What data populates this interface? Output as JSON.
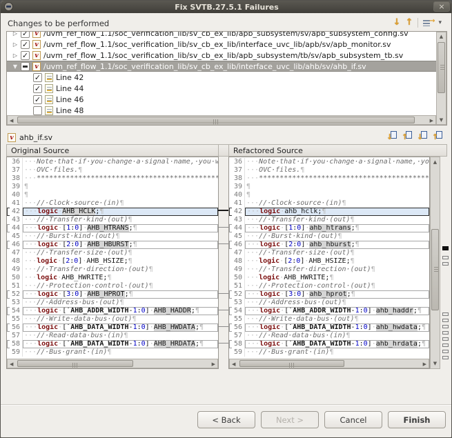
{
  "window": {
    "title": "Fix SVTB.27.5.1 Failures"
  },
  "icons": {
    "close": "×",
    "down_arrow": "↓",
    "up_arrow": "↑",
    "chevron": "▾",
    "filter_arrow": "→",
    "collapsed": "▷",
    "expanded": "▼",
    "check": "✓",
    "sv_letter": "v",
    "scroll_up": "▲",
    "scroll_down": "▼",
    "scroll_left": "◀",
    "scroll_right": "▶"
  },
  "changes": {
    "label": "Changes to be performed",
    "tree": [
      {
        "kind": "file",
        "expander": "collapsed",
        "check": "checked",
        "clipped": true,
        "label": "/uvm_ref_flow_1.1/soc_verification_lib/sv_cb_ex_lib/apb_subsystem/sv/apb_subsystem_config.sv"
      },
      {
        "kind": "file",
        "expander": "collapsed",
        "check": "checked",
        "label": "/uvm_ref_flow_1.1/soc_verification_lib/sv_cb_ex_lib/interface_uvc_lib/apb/sv/apb_monitor.sv"
      },
      {
        "kind": "file",
        "expander": "collapsed",
        "check": "checked",
        "label": "/uvm_ref_flow_1.1/soc_verification_lib/sv_cb_ex_lib/apb_subsystem/tb/sv/apb_subsystem_tb.sv"
      },
      {
        "kind": "file",
        "expander": "expanded",
        "check": "partial",
        "selected": true,
        "label": "/uvm_ref_flow_1.1/soc_verification_lib/sv_cb_ex_lib/interface_uvc_lib/ahb/sv/ahb_if.sv"
      },
      {
        "kind": "line",
        "check": "checked",
        "indent": 1,
        "label": "Line 42"
      },
      {
        "kind": "line",
        "check": "checked",
        "indent": 1,
        "label": "Line 44"
      },
      {
        "kind": "line",
        "check": "checked",
        "indent": 1,
        "label": "Line 46"
      },
      {
        "kind": "line",
        "check": "unchecked",
        "indent": 1,
        "label": "Line 48"
      }
    ]
  },
  "compare": {
    "file": "ahb_if.sv",
    "left_header": "Original Source",
    "right_header": "Refactored Source",
    "ruler": {
      "current": 130,
      "others": [
        144,
        153,
        226,
        235,
        244,
        253,
        262,
        271,
        280,
        289
      ]
    },
    "lines": [
      {
        "num": 36,
        "left": [
          [
            "ws",
            "···"
          ],
          [
            "com",
            "Note·that·if·you·change·a·signal·name,·you·will·need·to·update"
          ],
          [
            "ws",
            "¶"
          ]
        ]
      },
      {
        "num": 37,
        "left": [
          [
            "ws",
            "···"
          ],
          [
            "com",
            "OVC·files."
          ],
          [
            "ws",
            "¶"
          ]
        ]
      },
      {
        "num": 38,
        "left": [
          [
            "ws",
            "···"
          ],
          [
            "com",
            "*********************************************************************"
          ]
        ]
      },
      {
        "num": 39,
        "left": [
          [
            "ws",
            "¶"
          ]
        ]
      },
      {
        "num": 40,
        "left": [
          [
            "ws",
            "¶"
          ]
        ]
      },
      {
        "num": 41,
        "left": [
          [
            "ws",
            "···"
          ],
          [
            "com",
            "//·Clock·source·(in)"
          ],
          [
            "ws",
            "¶"
          ]
        ]
      },
      {
        "num": 42,
        "diff": "selected",
        "left": [
          [
            "ws",
            "···"
          ],
          [
            "kw",
            "logic"
          ],
          [
            "ws",
            "·"
          ],
          [
            "chg",
            "AHB_HCLK"
          ],
          [
            "pln",
            ";"
          ],
          [
            "ws",
            "¶"
          ]
        ],
        "right": [
          [
            "ws",
            "···"
          ],
          [
            "kw",
            "logic"
          ],
          [
            "ws",
            "·"
          ],
          [
            "pln",
            "ahb_hclk"
          ],
          [
            "pln",
            ";"
          ],
          [
            "ws",
            "¶"
          ]
        ]
      },
      {
        "num": 43,
        "left": [
          [
            "ws",
            "···"
          ],
          [
            "com",
            "//·Transfer·kind·(out)"
          ],
          [
            "ws",
            "¶"
          ]
        ]
      },
      {
        "num": 44,
        "diff": "changed",
        "left": [
          [
            "ws",
            "···"
          ],
          [
            "kw",
            "logic"
          ],
          [
            "ws",
            "·"
          ],
          [
            "pln",
            "["
          ],
          [
            "num",
            "1"
          ],
          [
            "pln",
            ":"
          ],
          [
            "num",
            "0"
          ],
          [
            "pln",
            "]"
          ],
          [
            "ws",
            "·"
          ],
          [
            "chg",
            "AHB_HTRANS"
          ],
          [
            "pln",
            ";"
          ],
          [
            "ws",
            "¶"
          ]
        ],
        "right": [
          [
            "ws",
            "···"
          ],
          [
            "kw",
            "logic"
          ],
          [
            "ws",
            "·"
          ],
          [
            "pln",
            "["
          ],
          [
            "num",
            "1"
          ],
          [
            "pln",
            ":"
          ],
          [
            "num",
            "0"
          ],
          [
            "pln",
            "]"
          ],
          [
            "ws",
            "·"
          ],
          [
            "chg",
            "ahb_htrans"
          ],
          [
            "pln",
            ";"
          ],
          [
            "ws",
            "¶"
          ]
        ]
      },
      {
        "num": 45,
        "left": [
          [
            "ws",
            "···"
          ],
          [
            "com",
            "//·Burst·kind·(out)"
          ],
          [
            "ws",
            "¶"
          ]
        ]
      },
      {
        "num": 46,
        "diff": "changed",
        "left": [
          [
            "ws",
            "···"
          ],
          [
            "kw",
            "logic"
          ],
          [
            "ws",
            "·"
          ],
          [
            "pln",
            "["
          ],
          [
            "num",
            "2"
          ],
          [
            "pln",
            ":"
          ],
          [
            "num",
            "0"
          ],
          [
            "pln",
            "]"
          ],
          [
            "ws",
            "·"
          ],
          [
            "chg",
            "AHB_HBURST"
          ],
          [
            "pln",
            ";"
          ],
          [
            "ws",
            "¶"
          ]
        ],
        "right": [
          [
            "ws",
            "···"
          ],
          [
            "kw",
            "logic"
          ],
          [
            "ws",
            "·"
          ],
          [
            "pln",
            "["
          ],
          [
            "num",
            "2"
          ],
          [
            "pln",
            ":"
          ],
          [
            "num",
            "0"
          ],
          [
            "pln",
            "]"
          ],
          [
            "ws",
            "·"
          ],
          [
            "chg",
            "ahb_hburst"
          ],
          [
            "pln",
            ";"
          ],
          [
            "ws",
            "¶"
          ]
        ]
      },
      {
        "num": 47,
        "left": [
          [
            "ws",
            "···"
          ],
          [
            "com",
            "//·Transfer·size·(out)"
          ],
          [
            "ws",
            "¶"
          ]
        ]
      },
      {
        "num": 48,
        "left": [
          [
            "ws",
            "···"
          ],
          [
            "kw",
            "logic"
          ],
          [
            "ws",
            "·"
          ],
          [
            "pln",
            "["
          ],
          [
            "num",
            "2"
          ],
          [
            "pln",
            ":"
          ],
          [
            "num",
            "0"
          ],
          [
            "pln",
            "]"
          ],
          [
            "ws",
            "·"
          ],
          [
            "pln",
            "AHB_HSIZE"
          ],
          [
            "pln",
            ";"
          ],
          [
            "ws",
            "¶"
          ]
        ]
      },
      {
        "num": 49,
        "left": [
          [
            "ws",
            "···"
          ],
          [
            "com",
            "//·Transfer·direction·(out)"
          ],
          [
            "ws",
            "¶"
          ]
        ]
      },
      {
        "num": 50,
        "left": [
          [
            "ws",
            "···"
          ],
          [
            "kw",
            "logic"
          ],
          [
            "ws",
            "·"
          ],
          [
            "pln",
            "AHB_HWRITE"
          ],
          [
            "pln",
            ";"
          ],
          [
            "ws",
            "¶"
          ]
        ]
      },
      {
        "num": 51,
        "left": [
          [
            "ws",
            "···"
          ],
          [
            "com",
            "//·Protection·control·(out)"
          ],
          [
            "ws",
            "¶"
          ]
        ]
      },
      {
        "num": 52,
        "diff": "changed",
        "left": [
          [
            "ws",
            "···"
          ],
          [
            "kw",
            "logic"
          ],
          [
            "ws",
            "·"
          ],
          [
            "pln",
            "["
          ],
          [
            "num",
            "3"
          ],
          [
            "pln",
            ":"
          ],
          [
            "num",
            "0"
          ],
          [
            "pln",
            "]"
          ],
          [
            "ws",
            "·"
          ],
          [
            "chg",
            "AHB_HPROT"
          ],
          [
            "pln",
            ";"
          ],
          [
            "ws",
            "¶"
          ]
        ],
        "right": [
          [
            "ws",
            "···"
          ],
          [
            "kw",
            "logic"
          ],
          [
            "ws",
            "·"
          ],
          [
            "pln",
            "["
          ],
          [
            "num",
            "3"
          ],
          [
            "pln",
            ":"
          ],
          [
            "num",
            "0"
          ],
          [
            "pln",
            "]"
          ],
          [
            "ws",
            "·"
          ],
          [
            "chg",
            "ahb_hprot"
          ],
          [
            "pln",
            ";"
          ],
          [
            "ws",
            "¶"
          ]
        ]
      },
      {
        "num": 53,
        "left": [
          [
            "ws",
            "···"
          ],
          [
            "com",
            "//·Address·bus·(out)"
          ],
          [
            "ws",
            "¶"
          ]
        ]
      },
      {
        "num": 54,
        "diff": "changed",
        "left": [
          [
            "ws",
            "···"
          ],
          [
            "kw",
            "logic"
          ],
          [
            "ws",
            "·"
          ],
          [
            "pln",
            "["
          ],
          [
            "mac",
            "`AHB_ADDR_WIDTH"
          ],
          [
            "pln",
            "-"
          ],
          [
            "num",
            "1"
          ],
          [
            "pln",
            ":"
          ],
          [
            "num",
            "0"
          ],
          [
            "pln",
            "]"
          ],
          [
            "ws",
            "·"
          ],
          [
            "chg",
            "AHB_HADDR"
          ],
          [
            "pln",
            ";"
          ],
          [
            "ws",
            "¶"
          ]
        ],
        "right": [
          [
            "ws",
            "···"
          ],
          [
            "kw",
            "logic"
          ],
          [
            "ws",
            "·"
          ],
          [
            "pln",
            "["
          ],
          [
            "mac",
            "`AHB_ADDR_WIDTH"
          ],
          [
            "pln",
            "-"
          ],
          [
            "num",
            "1"
          ],
          [
            "pln",
            ":"
          ],
          [
            "num",
            "0"
          ],
          [
            "pln",
            "]"
          ],
          [
            "ws",
            "·"
          ],
          [
            "chg",
            "ahb_haddr"
          ],
          [
            "pln",
            ";"
          ],
          [
            "ws",
            "¶"
          ]
        ]
      },
      {
        "num": 55,
        "left": [
          [
            "ws",
            "···"
          ],
          [
            "com",
            "//·Write·data·bus·(out)"
          ],
          [
            "ws",
            "¶"
          ]
        ]
      },
      {
        "num": 56,
        "diff": "changed",
        "left": [
          [
            "ws",
            "···"
          ],
          [
            "kw",
            "logic"
          ],
          [
            "ws",
            "·"
          ],
          [
            "pln",
            "["
          ],
          [
            "mac",
            "`AHB_DATA_WIDTH"
          ],
          [
            "pln",
            "-"
          ],
          [
            "num",
            "1"
          ],
          [
            "pln",
            ":"
          ],
          [
            "num",
            "0"
          ],
          [
            "pln",
            "]"
          ],
          [
            "ws",
            "·"
          ],
          [
            "chg",
            "AHB_HWDATA"
          ],
          [
            "pln",
            ";"
          ],
          [
            "ws",
            "¶"
          ]
        ],
        "right": [
          [
            "ws",
            "···"
          ],
          [
            "kw",
            "logic"
          ],
          [
            "ws",
            "·"
          ],
          [
            "pln",
            "["
          ],
          [
            "mac",
            "`AHB_DATA_WIDTH"
          ],
          [
            "pln",
            "-"
          ],
          [
            "num",
            "1"
          ],
          [
            "pln",
            ":"
          ],
          [
            "num",
            "0"
          ],
          [
            "pln",
            "]"
          ],
          [
            "ws",
            "·"
          ],
          [
            "chg",
            "ahb_hwdata"
          ],
          [
            "pln",
            ";"
          ],
          [
            "ws",
            "¶"
          ]
        ]
      },
      {
        "num": 57,
        "left": [
          [
            "ws",
            "···"
          ],
          [
            "com",
            "//·Read·data·bus·(in)"
          ],
          [
            "ws",
            "¶"
          ]
        ]
      },
      {
        "num": 58,
        "diff": "changed",
        "left": [
          [
            "ws",
            "···"
          ],
          [
            "kw",
            "logic"
          ],
          [
            "ws",
            "·"
          ],
          [
            "pln",
            "["
          ],
          [
            "mac",
            "`AHB_DATA_WIDTH"
          ],
          [
            "pln",
            "-"
          ],
          [
            "num",
            "1"
          ],
          [
            "pln",
            ":"
          ],
          [
            "num",
            "0"
          ],
          [
            "pln",
            "]"
          ],
          [
            "ws",
            "·"
          ],
          [
            "chg",
            "AHB_HRDATA"
          ],
          [
            "pln",
            ";"
          ],
          [
            "ws",
            "¶"
          ]
        ],
        "right": [
          [
            "ws",
            "···"
          ],
          [
            "kw",
            "logic"
          ],
          [
            "ws",
            "·"
          ],
          [
            "pln",
            "["
          ],
          [
            "mac",
            "`AHB_DATA_WIDTH"
          ],
          [
            "pln",
            "-"
          ],
          [
            "num",
            "1"
          ],
          [
            "pln",
            ":"
          ],
          [
            "num",
            "0"
          ],
          [
            "pln",
            "]"
          ],
          [
            "ws",
            "·"
          ],
          [
            "chg",
            "ahb_hrdata"
          ],
          [
            "pln",
            ";"
          ],
          [
            "ws",
            "¶"
          ]
        ]
      },
      {
        "num": 59,
        "left": [
          [
            "ws",
            "···"
          ],
          [
            "com",
            "//·Bus·grant·(in)"
          ],
          [
            "ws",
            "¶"
          ]
        ]
      }
    ]
  },
  "buttons": {
    "back": "< Back",
    "next": "Next >",
    "cancel": "Cancel",
    "finish": "Finish"
  }
}
